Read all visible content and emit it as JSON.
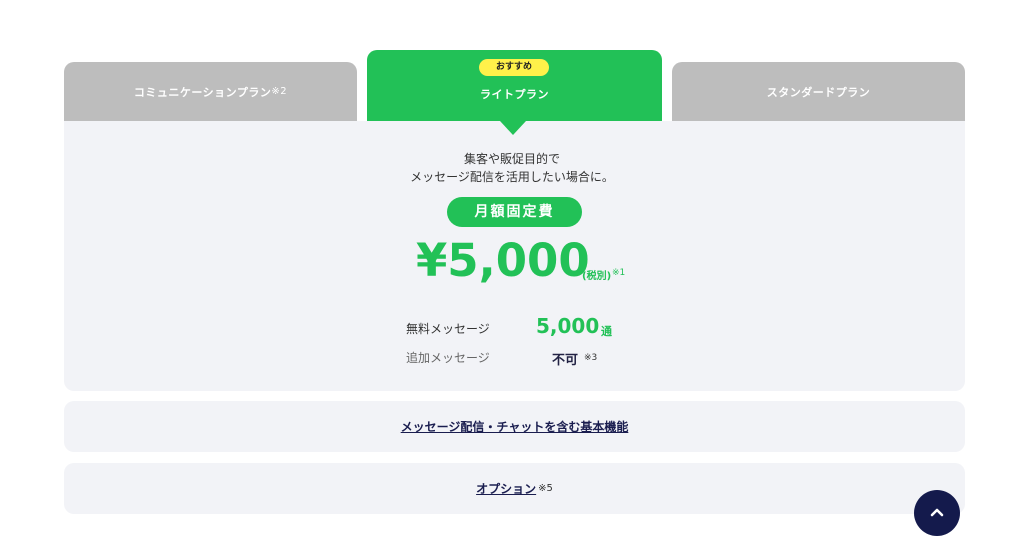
{
  "tabs": [
    {
      "label": "コミュニケーションプラン",
      "note": "※2"
    },
    {
      "label": "ライトプラン",
      "badge": "おすすめ"
    },
    {
      "label": "スタンダードプラン"
    }
  ],
  "plan": {
    "description_line1": "集客や販促目的で",
    "description_line2": "メッセージ配信を活用したい場合に。",
    "fee_label": "月額固定費",
    "price": "¥5,000",
    "tax_label": "(税別)",
    "price_note": "※1",
    "free_messages_label": "無料メッセージ",
    "free_messages_value": "5,000",
    "free_messages_unit": "通",
    "additional_messages_label": "追加メッセージ",
    "additional_messages_value": "不可",
    "additional_messages_note": "※3"
  },
  "links": {
    "features": "メッセージ配信・チャットを含む基本機能",
    "options": "オプション",
    "options_note": "※5"
  },
  "colors": {
    "accent": "#22c157",
    "badge": "#fff14a",
    "inactive_tab": "#bdbdbd",
    "panel": "#f2f3f7",
    "navy": "#141a4c"
  },
  "icons": {
    "scroll_top": "chevron-up-icon"
  }
}
